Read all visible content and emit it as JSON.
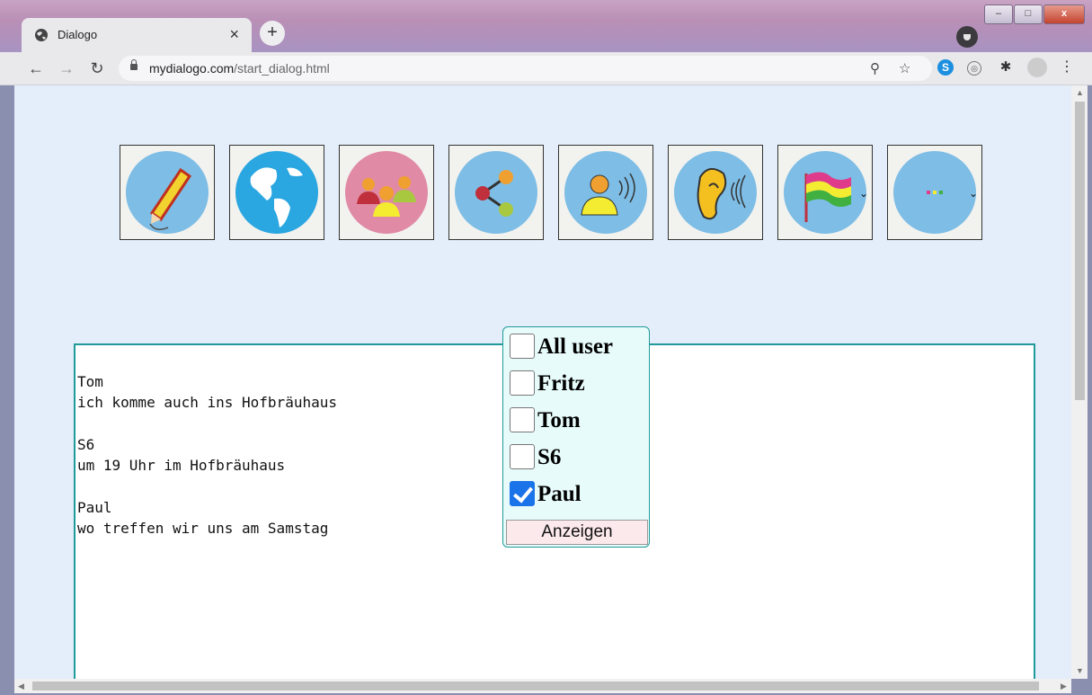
{
  "browser": {
    "tab_title": "Dialogo",
    "tab_close": "×",
    "new_tab": "+",
    "url_host": "mydialogo.com",
    "url_path": "/start_dialog.html",
    "window_minimize": "–",
    "window_maximize": "□",
    "window_close": "x"
  },
  "toolbar_icons": [
    {
      "name": "pencil-icon",
      "color": "#7dbde6"
    },
    {
      "name": "globe-icon",
      "color": "#2aa6e0"
    },
    {
      "name": "users-group-icon",
      "color": "#e08aa5"
    },
    {
      "name": "share-icon",
      "color": "#7dbde6"
    },
    {
      "name": "user-speaking-icon",
      "color": "#7dbde6"
    },
    {
      "name": "ear-listening-icon",
      "color": "#7dbde6"
    },
    {
      "name": "flag-language-icon",
      "color": "#7dbde6"
    },
    {
      "name": "more-options-icon",
      "color": "#7dbde6"
    }
  ],
  "messages": [
    {
      "sender": "Tom",
      "text": "ich komme auch ins Hofbräuhaus"
    },
    {
      "sender": "S6",
      "text": "um 19 Uhr im Hofbräuhaus"
    },
    {
      "sender": "Paul",
      "text": "wo treffen wir uns am Samstag"
    }
  ],
  "user_filter": {
    "options": [
      {
        "label": "All user",
        "checked": false
      },
      {
        "label": "Fritz",
        "checked": false
      },
      {
        "label": "Tom",
        "checked": false
      },
      {
        "label": "S6",
        "checked": false
      },
      {
        "label": "Paul",
        "checked": true
      }
    ],
    "show_button": "Anzeigen"
  },
  "colors": {
    "page_bg": "#e3eefa",
    "chat_border": "#209a9a",
    "dropdown_bg": "#e8fbfb",
    "checkbox_checked": "#1a73e8"
  }
}
